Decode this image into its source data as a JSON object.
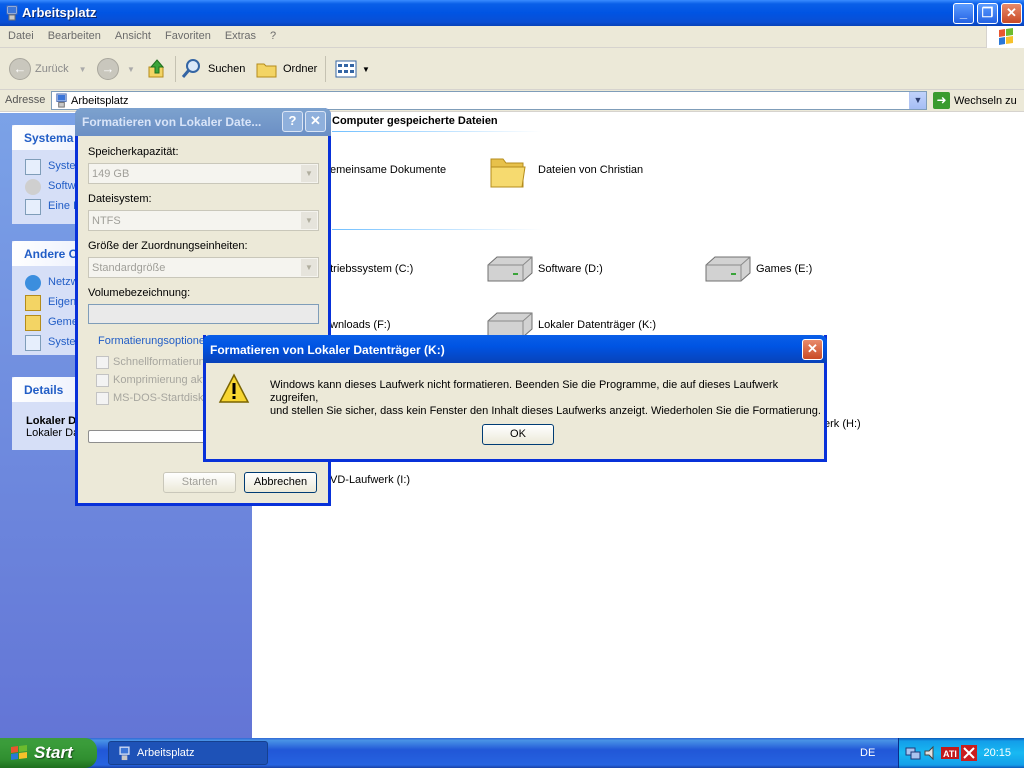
{
  "window": {
    "title": "Arbeitsplatz",
    "controls": {
      "minimize": "_",
      "maximize": "❐",
      "close": "✕"
    }
  },
  "menu": [
    "Datei",
    "Bearbeiten",
    "Ansicht",
    "Favoriten",
    "Extras",
    "?"
  ],
  "toolbar": {
    "back": "Zurück",
    "search": "Suchen",
    "folders": "Ordner"
  },
  "address": {
    "label": "Adresse",
    "value": "Arbeitsplatz",
    "go": "Wechseln zu"
  },
  "leftpanel": {
    "system_tasks": {
      "title": "Systema",
      "items": [
        "Syste",
        "Softw",
        "Eine E"
      ]
    },
    "other_places": {
      "title": "Andere O",
      "items": [
        "Netzw",
        "Eigen",
        "Geme",
        "Syste"
      ]
    },
    "details": {
      "title": "Details",
      "name": "Lokaler D",
      "type": "Lokaler Da"
    }
  },
  "content": {
    "section_files": "Computer gespeicherte Dateien",
    "files": [
      {
        "label": "emeinsame Dokumente",
        "icon": "folder-icon"
      },
      {
        "label": "Dateien von Christian",
        "icon": "folder-icon"
      }
    ],
    "drives": [
      {
        "label": "etriebssystem (C:)",
        "icon": "hard-drive-icon"
      },
      {
        "label": "Software (D:)",
        "icon": "hard-drive-icon"
      },
      {
        "label": "Games (E:)",
        "icon": "hard-drive-icon"
      },
      {
        "label": "wnloads (F:)",
        "icon": "hard-drive-icon"
      },
      {
        "label": "Lokaler Datenträger (K:)",
        "icon": "hard-drive-icon"
      }
    ],
    "removable": [
      {
        "label": "erk (H:)",
        "icon": "cd-drive-icon"
      },
      {
        "label": "VD-Laufwerk (I:)",
        "icon": "dvd-drive-icon"
      }
    ]
  },
  "format_dialog": {
    "title": "Formatieren von Lokaler Date...",
    "help": "?",
    "close": "✕",
    "capacity_label": "Speicherkapazität:",
    "capacity_value": "149 GB",
    "fs_label": "Dateisystem:",
    "fs_value": "NTFS",
    "alloc_label": "Größe der Zuordnungseinheiten:",
    "alloc_value": "Standardgröße",
    "volume_label": "Volumebezeichnung:",
    "volume_value": "",
    "options_label": "Formatierungsoptionen",
    "options": [
      "Schnellformatierung",
      "Komprimierung aktiv",
      "MS-DOS-Startdiske"
    ],
    "start": "Starten",
    "cancel": "Abbrechen"
  },
  "message": {
    "title": "Formatieren von Lokaler Datenträger (K:)",
    "close": "✕",
    "text_line1": "Windows kann dieses Laufwerk nicht formatieren. Beenden Sie die Programme, die auf dieses Laufwerk zugreifen,",
    "text_line2": "und stellen Sie sicher, dass kein Fenster den Inhalt dieses Laufwerks anzeigt. Wiederholen Sie die Formatierung.",
    "ok": "OK"
  },
  "taskbar": {
    "start": "Start",
    "task": "Arbeitsplatz",
    "language": "DE",
    "tray_icons": [
      "network-icon",
      "volume-icon",
      "ati-icon",
      "antivirus-icon"
    ],
    "clock": "20:15"
  }
}
